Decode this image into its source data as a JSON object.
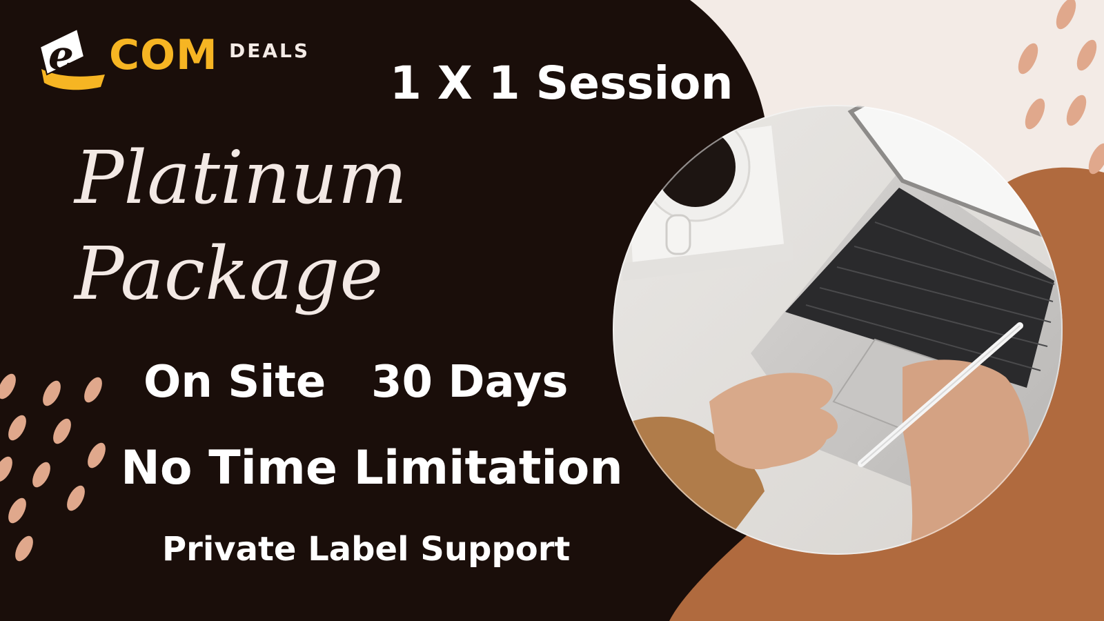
{
  "brand": {
    "logo_mark": "e",
    "logo_com": "COM",
    "logo_deals": "DEALS",
    "primary_color": "#f6b523"
  },
  "headline": {
    "session": "1 X 1 Session",
    "package_line1": "Platinum",
    "package_line2": "Package"
  },
  "features": {
    "on_site": "On Site",
    "duration": "30 Days",
    "limitation": "No Time Limitation",
    "support": "Private Label Support"
  },
  "colors": {
    "background_dark": "#1a0e0a",
    "cream": "#f3ebe6",
    "terracotta": "#b06a3e",
    "dots": "#e0a88c"
  },
  "photo": {
    "icon": "laptop-typing-photo"
  }
}
